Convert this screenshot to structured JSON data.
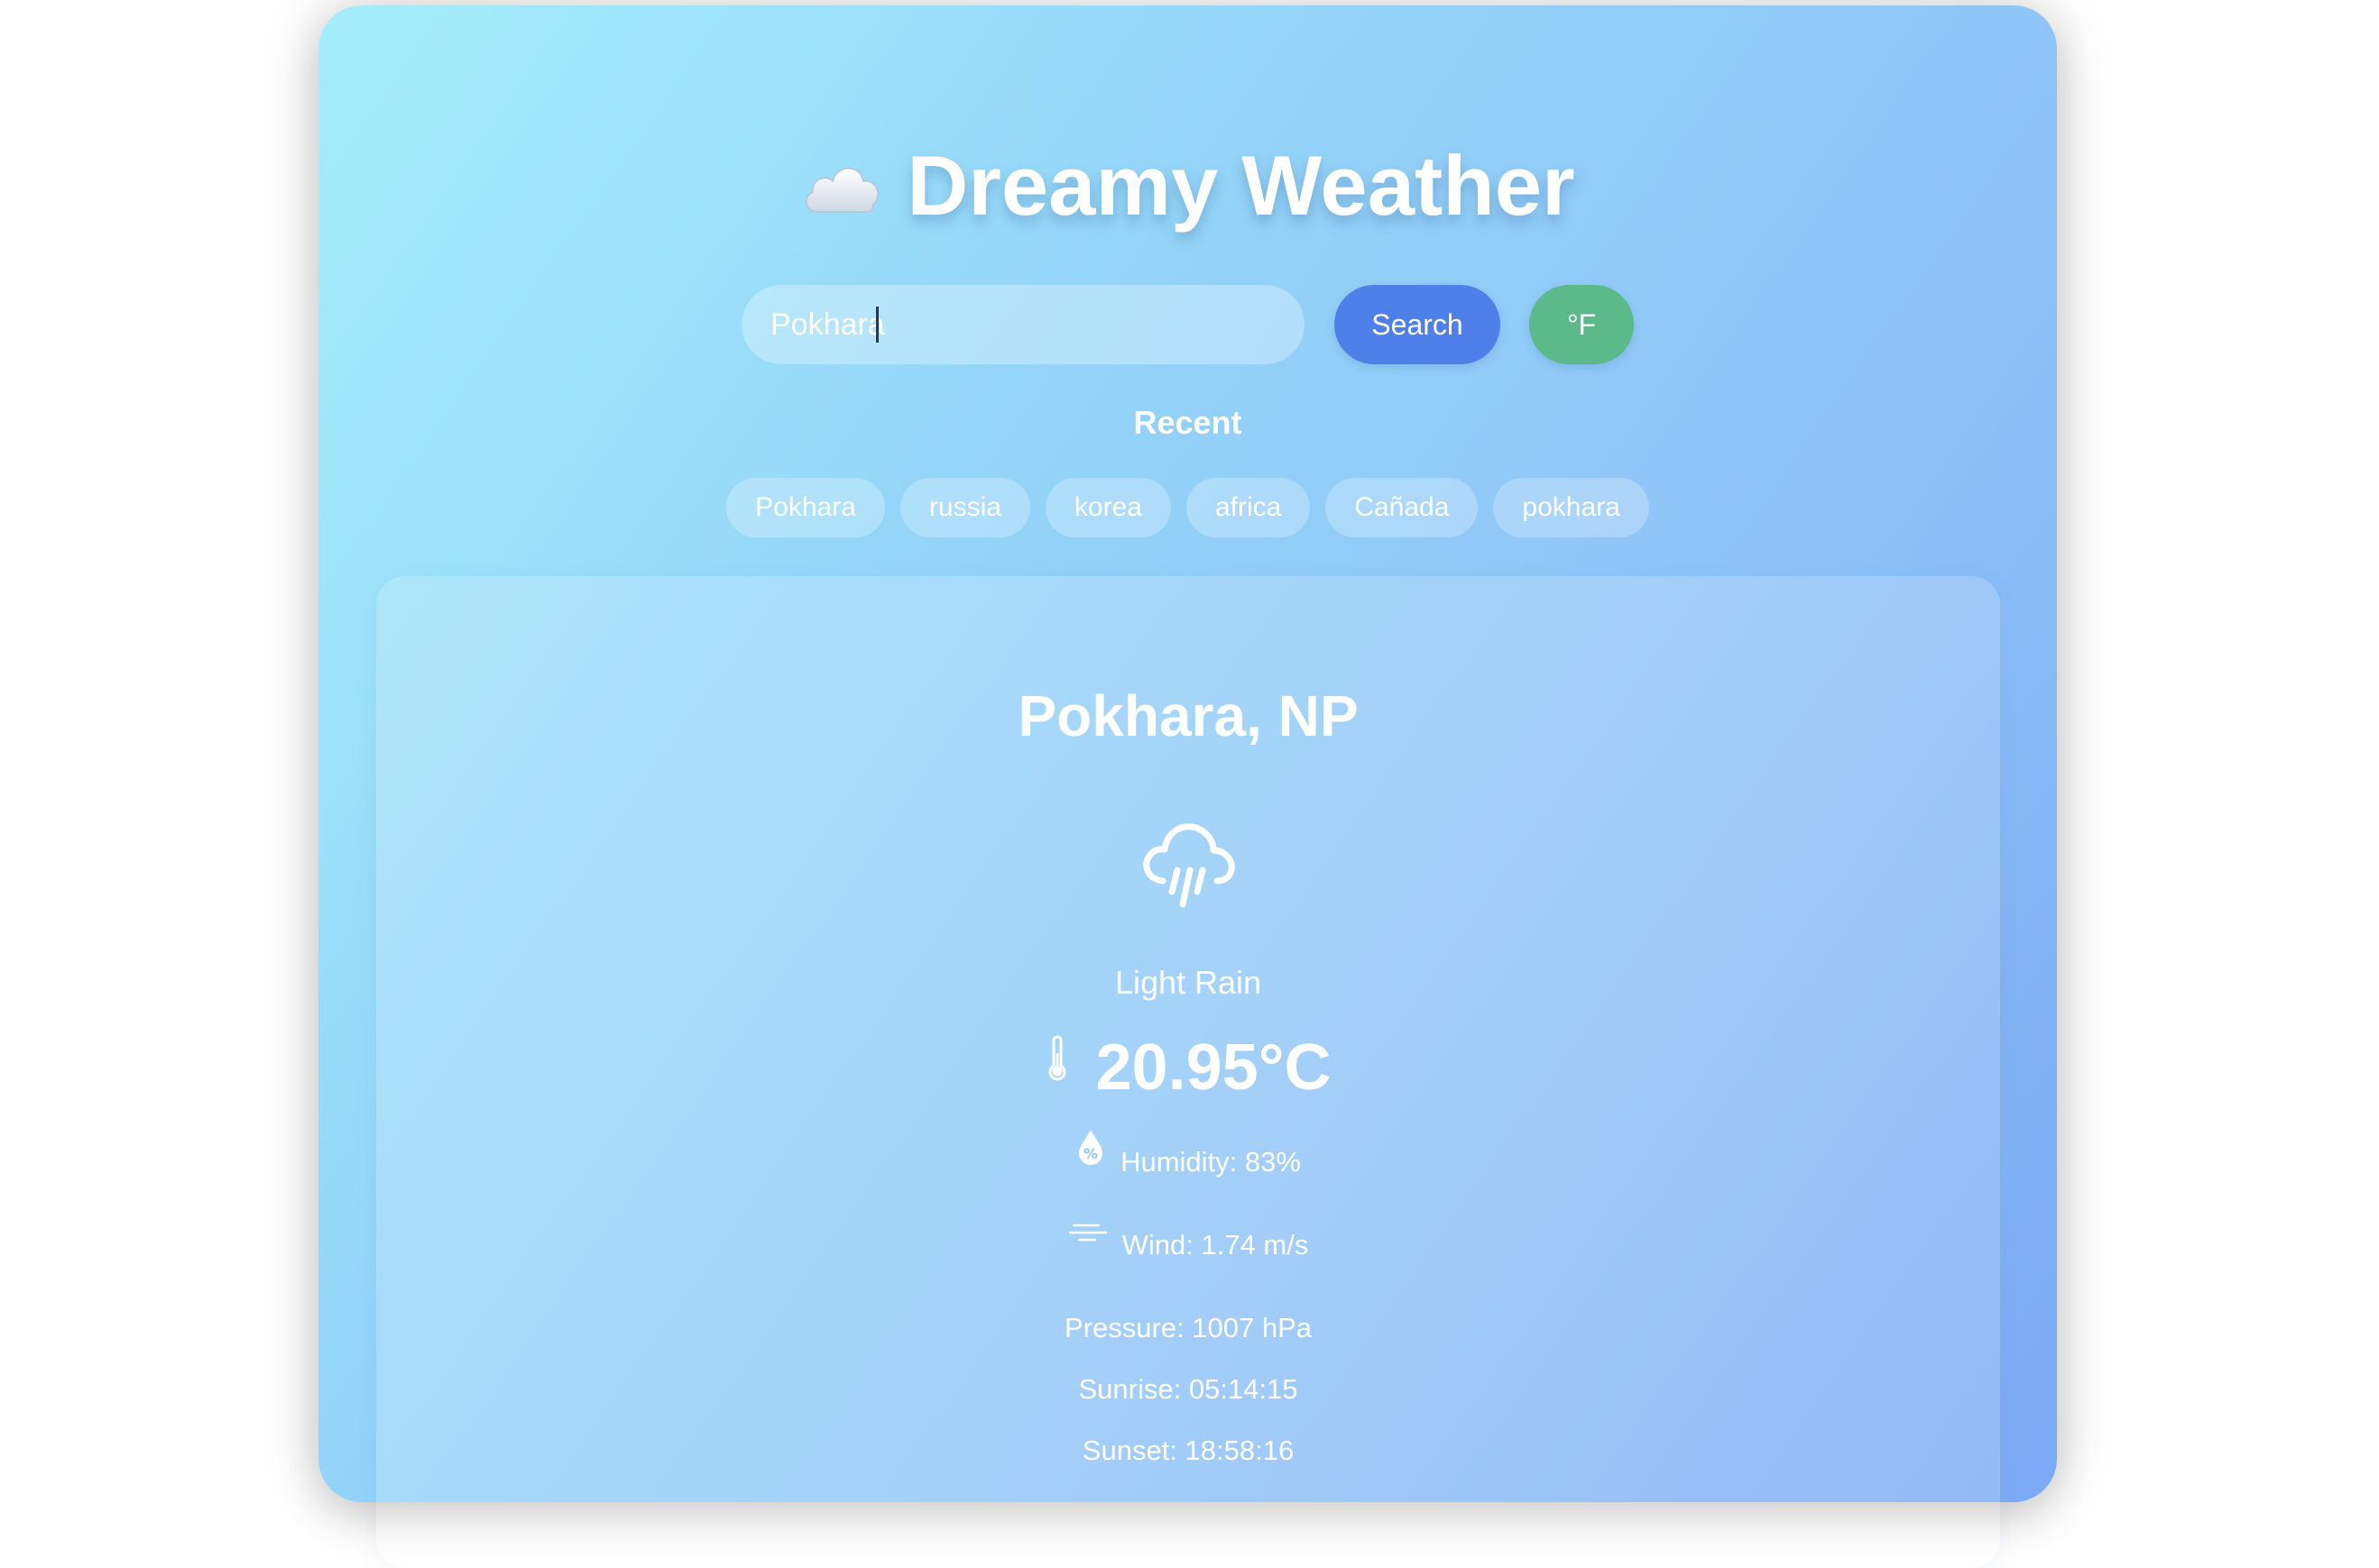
{
  "app": {
    "title": "Dreamy Weather",
    "title_icon": "cloud-icon"
  },
  "search": {
    "value": "Pokhara",
    "placeholder": "",
    "search_label": "Search",
    "unit_toggle_label": "°F"
  },
  "recent": {
    "label": "Recent",
    "items": [
      "Pokhara",
      "russia",
      "korea",
      "africa",
      "Cañada",
      "pokhara"
    ]
  },
  "weather": {
    "location": "Pokhara, NP",
    "condition_icon": "rain-icon",
    "description": "Light Rain",
    "temperature": "20.95°C",
    "humidity": "Humidity: 83%",
    "wind": "Wind: 1.74 m/s",
    "pressure": "Pressure: 1007 hPa",
    "sunrise": "Sunrise: 05:14:15",
    "sunset": "Sunset: 18:58:16"
  },
  "colors": {
    "gradient_start": "#a6eefb",
    "gradient_end": "#7ba9f4",
    "search_button": "#4f80ea",
    "unit_button": "#5bb98a",
    "text": "#ffffff"
  }
}
